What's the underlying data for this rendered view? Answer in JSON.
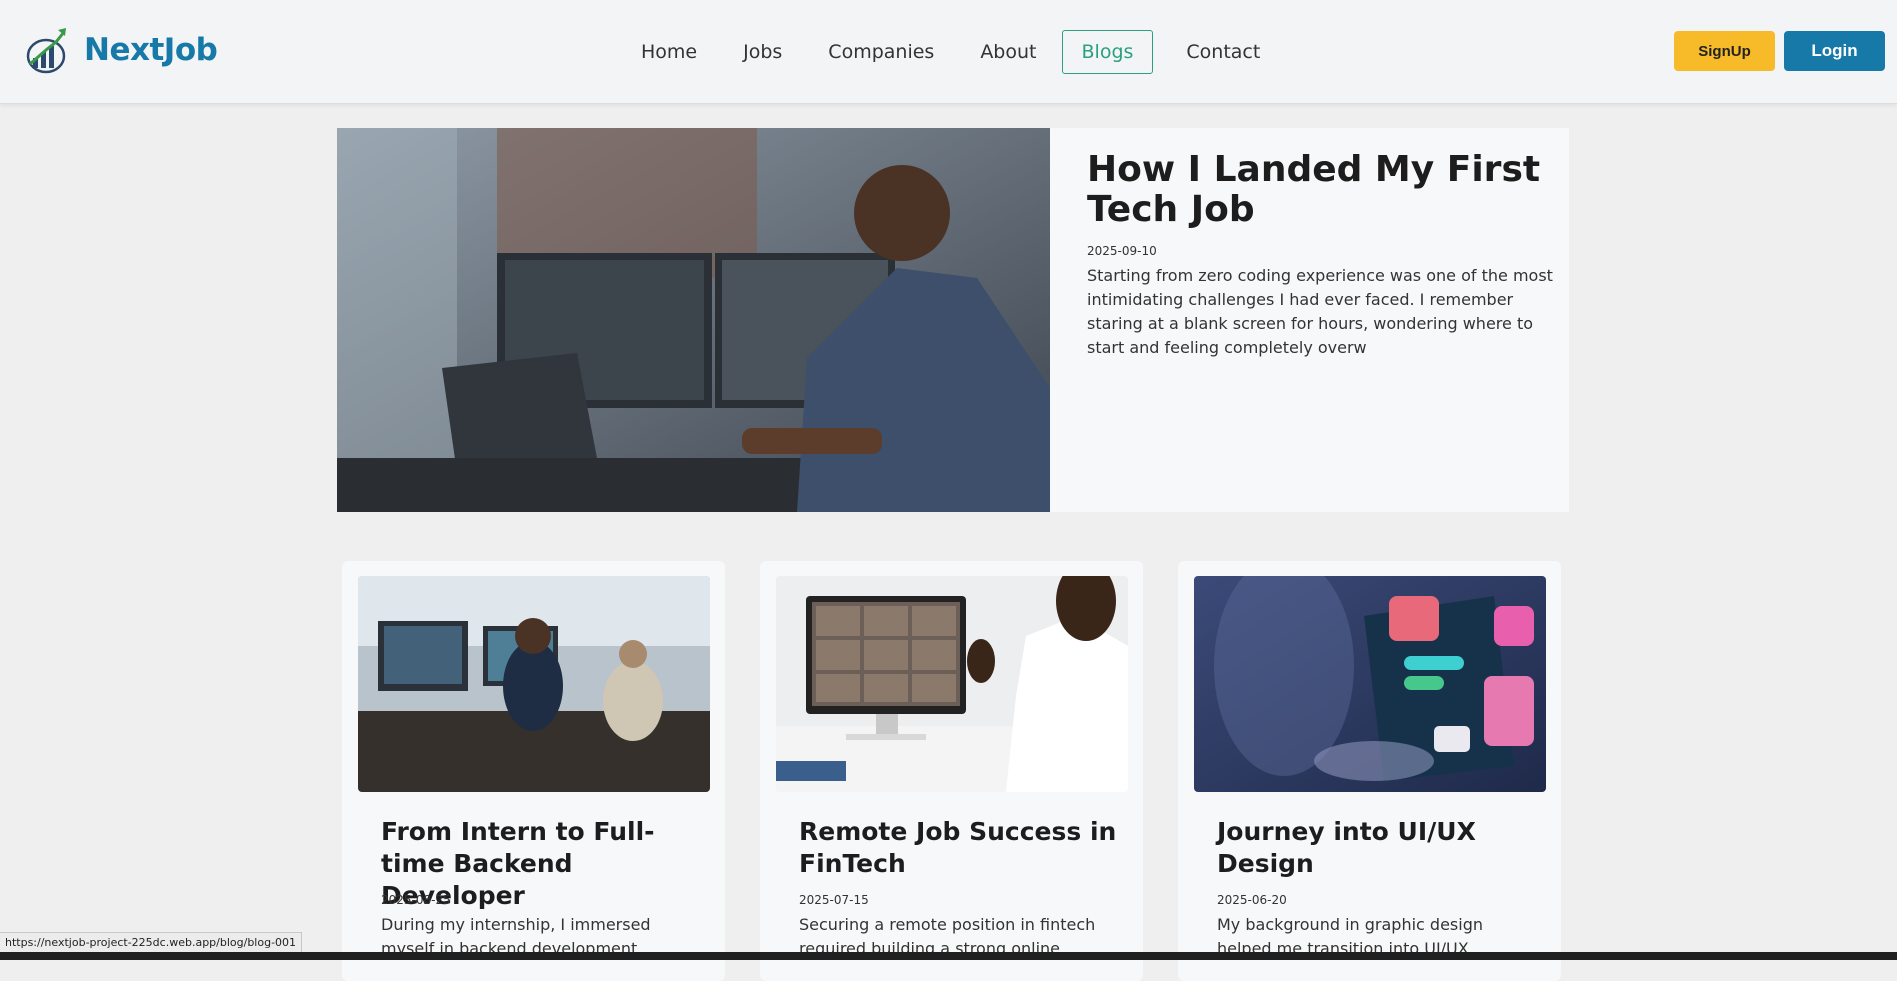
{
  "header": {
    "brand": "NextJob",
    "nav": [
      {
        "label": "Home",
        "active": false
      },
      {
        "label": "Jobs",
        "active": false
      },
      {
        "label": "Companies",
        "active": false
      },
      {
        "label": "About",
        "active": false
      },
      {
        "label": "Blogs",
        "active": true
      },
      {
        "label": "Contact",
        "active": false
      }
    ],
    "signup_label": "SignUp",
    "login_label": "Login"
  },
  "featured": {
    "title": "How I Landed My First Tech Job",
    "date": "2025-09-10",
    "excerpt": "Starting from zero coding experience was one of the most intimidating challenges I had ever faced. I remember staring at a blank screen for hours, wondering where to start and feeling completely overw",
    "image": "developer-at-desk-photo"
  },
  "cards": [
    {
      "title": "From Intern to Full-time Backend Developer",
      "date": "2025-08-25",
      "excerpt": "During my internship, I immersed myself in backend development",
      "image": "office-developers-photo"
    },
    {
      "title": "Remote Job Success in FinTech",
      "date": "2025-07-15",
      "excerpt": "Securing a remote position in fintech required building a strong online",
      "image": "video-call-photo"
    },
    {
      "title": "Journey into UI/UX Design",
      "date": "2025-06-20",
      "excerpt": "My background in graphic design helped me transition into UI/UX",
      "image": "ui-ux-tablet-photo"
    }
  ],
  "status_url": "https://nextjob-project-225dc.web.app/blog/blog-001",
  "colors": {
    "brand": "#1679a8",
    "signup": "#f7bb2a",
    "active_nav": "#2ba07f",
    "page_bg": "#efefef"
  }
}
